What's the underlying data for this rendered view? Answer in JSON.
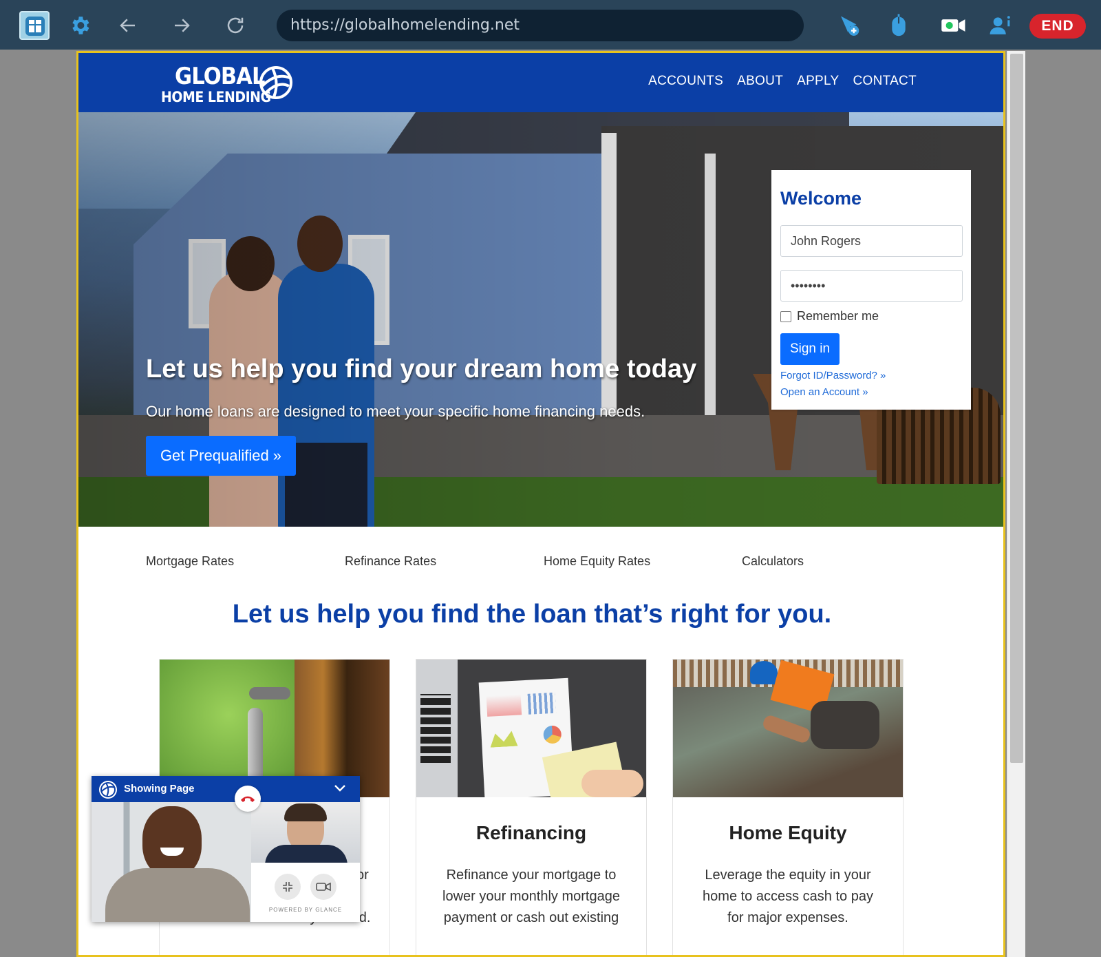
{
  "toolbar": {
    "url": "https://globalhomelending.net",
    "end_label": "END"
  },
  "site": {
    "brand_line1": "GLOBAL",
    "brand_line2": "HOME LENDING",
    "nav": [
      "ACCOUNTS",
      "ABOUT",
      "APPLY",
      "CONTACT"
    ],
    "brand_color": "#0b3fa6"
  },
  "hero": {
    "title": "Let us help you find your dream home today",
    "subtitle": "Our home loans are designed to meet your specific home financing needs.",
    "cta": "Get Prequalified »"
  },
  "login": {
    "title": "Welcome",
    "username_value": "John Rogers",
    "password_value": "••••••••",
    "remember_label": "Remember me",
    "signin_label": "Sign in",
    "forgot_link": "Forgot ID/Password? »",
    "open_link": "Open an Account »"
  },
  "rates": [
    "Mortgage Rates",
    "Refinance Rates",
    "Home Equity Rates",
    "Calculators"
  ],
  "section_title": "Let us help you find the loan that’s right for you.",
  "cards": [
    {
      "title": "",
      "partial_text_right": "or",
      "partial_text_bottom": "needs. Get the tools you need."
    },
    {
      "title": "Refinancing",
      "text": "Refinance your mortgage to lower your monthly mortgage payment or cash out existing"
    },
    {
      "title": "Home Equity",
      "text": "Leverage the equity in your home to access cash to pay for major expenses."
    }
  ],
  "video_widget": {
    "title": "Showing Page",
    "powered_by": "POWERED BY GLANCE"
  },
  "colors": {
    "accent_button": "#0a6cff",
    "end_button": "#d8242c",
    "frame_border": "#e8c21e",
    "toolbar_bg": "#2a4459"
  }
}
